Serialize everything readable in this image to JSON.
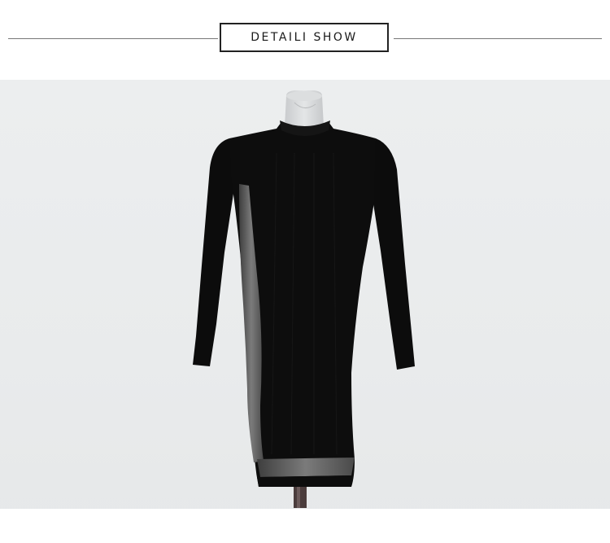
{
  "header": {
    "title": "DETAILI SHOW"
  },
  "photo": {
    "subject": "dress-on-mannequin",
    "colors": {
      "background": "#eaeced",
      "dress": "#0d0d0d",
      "trim": "#6a6a6a",
      "mannequin": "#d7d9db"
    }
  }
}
